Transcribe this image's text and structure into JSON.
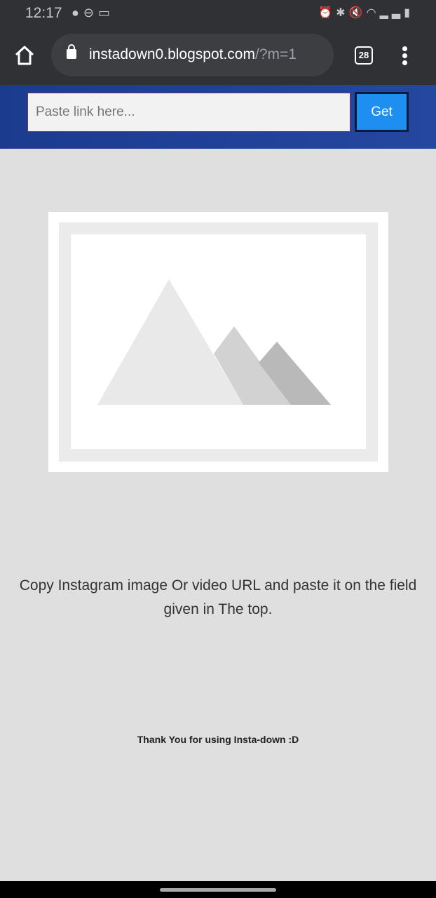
{
  "status_bar": {
    "time": "12:17",
    "left_icons": [
      "spotify-icon",
      "dnd-icon",
      "laptop-icon"
    ],
    "right_icons": [
      "alarm-icon",
      "bluetooth-icon",
      "mute-icon",
      "wifi-icon",
      "volte-icon",
      "signal-icon",
      "battery-icon"
    ]
  },
  "browser": {
    "url_host": "instadown0.blogspot.com",
    "url_path": "/?m=1",
    "tab_count": "28"
  },
  "header": {
    "input_placeholder": "Paste link here...",
    "get_label": "Get"
  },
  "main": {
    "message": "Copy Instagram image Or video URL and paste it on the field given in The top.",
    "thanks": "Thank You for using Insta-down :D"
  }
}
